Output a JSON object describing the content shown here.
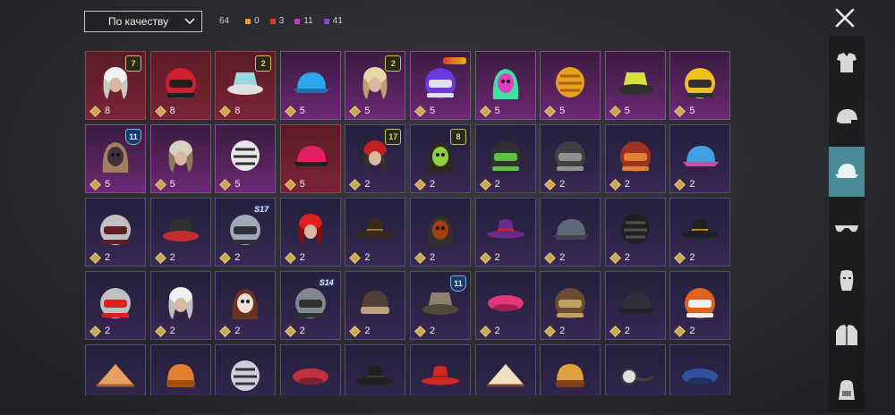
{
  "sort": {
    "label": "По качеству"
  },
  "counts": {
    "total": "64",
    "orange": {
      "value": "0",
      "color": "#e8a020"
    },
    "red": {
      "value": "3",
      "color": "#e03838"
    },
    "pink": {
      "value": "11",
      "color": "#c838c8"
    },
    "violet": {
      "value": "41",
      "color": "#8a48e0"
    }
  },
  "sidebar": [
    {
      "name": "clothing",
      "icon": "outfit-icon",
      "active": false
    },
    {
      "name": "helmet",
      "icon": "helmet-icon",
      "active": false
    },
    {
      "name": "hat",
      "icon": "cap-icon",
      "active": true
    },
    {
      "name": "glasses",
      "icon": "glasses-icon",
      "active": false
    },
    {
      "name": "mask",
      "icon": "mask-icon",
      "active": false
    },
    {
      "name": "jacket",
      "icon": "jacket-icon",
      "active": false
    },
    {
      "name": "backpack",
      "icon": "backpack-icon",
      "active": false
    }
  ],
  "items": [
    {
      "name": "white-wig",
      "rarity": "red",
      "value": "8",
      "badge": "7",
      "badge_type": "hex",
      "art": "wig",
      "c1": "#f0f0f0",
      "c2": "#c8c8c8"
    },
    {
      "name": "red-moto-helmet",
      "rarity": "red",
      "value": "8",
      "badge": "",
      "badge_type": "",
      "art": "helmet",
      "c1": "#d02030",
      "c2": "#202020"
    },
    {
      "name": "teal-bucket-hat",
      "rarity": "red",
      "value": "8",
      "badge": "2",
      "badge_type": "hex",
      "art": "bucket",
      "c1": "#9ad8e0",
      "c2": "#e0e0e0"
    },
    {
      "name": "blue-animal-cap",
      "rarity": "purple",
      "value": "5",
      "badge": "",
      "badge_type": "",
      "art": "cap",
      "c1": "#2aa8e8",
      "c2": "#1a70b0"
    },
    {
      "name": "blonde-pigtails",
      "rarity": "purple",
      "value": "5",
      "badge": "2",
      "badge_type": "hex",
      "art": "wig",
      "c1": "#e8d8a8",
      "c2": "#c0a070"
    },
    {
      "name": "purple-robot-helmet",
      "rarity": "purple",
      "value": "5",
      "badge": "",
      "badge_type": "logo",
      "art": "helmet",
      "c1": "#6a3ae0",
      "c2": "#e0e0f0"
    },
    {
      "name": "neon-mask-hood",
      "rarity": "purple",
      "value": "5",
      "badge": "",
      "badge_type": "",
      "art": "hood",
      "c1": "#e040c0",
      "c2": "#40e0a0"
    },
    {
      "name": "orange-creature-head",
      "rarity": "purple",
      "value": "5",
      "badge": "",
      "badge_type": "",
      "art": "ball",
      "c1": "#e8a020",
      "c2": "#a86010"
    },
    {
      "name": "yellow-bucket-hat",
      "rarity": "purple",
      "value": "5",
      "badge": "",
      "badge_type": "",
      "art": "bucket",
      "c1": "#d8e040",
      "c2": "#303030"
    },
    {
      "name": "yellow-helmet",
      "rarity": "purple",
      "value": "5",
      "badge": "",
      "badge_type": "",
      "art": "helmet",
      "c1": "#f0c020",
      "c2": "#303030"
    },
    {
      "name": "dark-animal-mask",
      "rarity": "purple",
      "value": "5",
      "badge": "11",
      "badge_type": "shield",
      "art": "hood",
      "c1": "#403040",
      "c2": "#a08060"
    },
    {
      "name": "dreadlock-lion",
      "rarity": "purple",
      "value": "5",
      "badge": "",
      "badge_type": "",
      "art": "wig",
      "c1": "#d8d0c0",
      "c2": "#8a7a60"
    },
    {
      "name": "zebra-mask",
      "rarity": "purple",
      "value": "5",
      "badge": "",
      "badge_type": "",
      "art": "ball",
      "c1": "#e8e8e8",
      "c2": "#303030"
    },
    {
      "name": "pink-bandana-cap",
      "rarity": "red",
      "value": "5",
      "badge": "",
      "badge_type": "",
      "art": "cap",
      "c1": "#e02060",
      "c2": "#202020"
    },
    {
      "name": "red-hair-hat",
      "rarity": "blue",
      "value": "2",
      "badge": "17",
      "badge_type": "hex",
      "art": "wig",
      "c1": "#c02020",
      "c2": "#303030"
    },
    {
      "name": "green-skull-hood",
      "rarity": "blue",
      "value": "2",
      "badge": "8",
      "badge_type": "hex",
      "art": "hood",
      "c1": "#90d040",
      "c2": "#302820"
    },
    {
      "name": "gas-mask-helmet",
      "rarity": "blue",
      "value": "2",
      "badge": "",
      "badge_type": "",
      "art": "helmet",
      "c1": "#303030",
      "c2": "#60c040"
    },
    {
      "name": "black-ops-helmet",
      "rarity": "blue",
      "value": "2",
      "badge": "",
      "badge_type": "",
      "art": "helmet",
      "c1": "#404040",
      "c2": "#909090"
    },
    {
      "name": "aviator-goggles-cap",
      "rarity": "blue",
      "value": "2",
      "badge": "",
      "badge_type": "",
      "art": "helmet",
      "c1": "#a03020",
      "c2": "#e08030"
    },
    {
      "name": "colorful-cap",
      "rarity": "blue",
      "value": "2",
      "badge": "",
      "badge_type": "",
      "art": "cap",
      "c1": "#40a0e0",
      "c2": "#e040a0"
    },
    {
      "name": "horned-helmet",
      "rarity": "blue",
      "value": "2",
      "badge": "",
      "badge_type": "",
      "art": "helmet",
      "c1": "#c0c0c8",
      "c2": "#602020"
    },
    {
      "name": "hooded-bucket",
      "rarity": "blue",
      "value": "2",
      "badge": "",
      "badge_type": "",
      "art": "bucket",
      "c1": "#303030",
      "c2": "#c03030"
    },
    {
      "name": "knight-helmet",
      "rarity": "blue",
      "value": "2",
      "badge": "S17",
      "badge_type": "season",
      "art": "helmet",
      "c1": "#a0a8b8",
      "c2": "#303038"
    },
    {
      "name": "red-mohawk",
      "rarity": "blue",
      "value": "2",
      "badge": "",
      "badge_type": "",
      "art": "wig",
      "c1": "#e02020",
      "c2": "#801010"
    },
    {
      "name": "steampunk-hat",
      "rarity": "blue",
      "value": "2",
      "badge": "",
      "badge_type": "",
      "art": "fedora",
      "c1": "#3a2a1a",
      "c2": "#a08040"
    },
    {
      "name": "cyber-mask",
      "rarity": "blue",
      "value": "2",
      "badge": "",
      "badge_type": "",
      "art": "hood",
      "c1": "#a04010",
      "c2": "#303030"
    },
    {
      "name": "purple-top-hat",
      "rarity": "blue",
      "value": "2",
      "badge": "",
      "badge_type": "",
      "art": "fedora",
      "c1": "#6a2a8a",
      "c2": "#e02020"
    },
    {
      "name": "grey-cap",
      "rarity": "blue",
      "value": "2",
      "badge": "",
      "badge_type": "",
      "art": "cap",
      "c1": "#606878",
      "c2": "#404450"
    },
    {
      "name": "black-gas-mask",
      "rarity": "blue",
      "value": "2",
      "badge": "",
      "badge_type": "",
      "art": "ball",
      "c1": "#202020",
      "c2": "#505050"
    },
    {
      "name": "black-fedora",
      "rarity": "blue",
      "value": "2",
      "badge": "",
      "badge_type": "",
      "art": "fedora",
      "c1": "#202020",
      "c2": "#c0a020"
    },
    {
      "name": "goggles-cap",
      "rarity": "blue",
      "value": "2",
      "badge": "",
      "badge_type": "",
      "art": "helmet",
      "c1": "#c0c0c0",
      "c2": "#e02020"
    },
    {
      "name": "white-turban",
      "rarity": "blue",
      "value": "2",
      "badge": "",
      "badge_type": "",
      "art": "wig",
      "c1": "#f0f0f0",
      "c2": "#c0c0c0"
    },
    {
      "name": "clown-mask",
      "rarity": "blue",
      "value": "2",
      "badge": "",
      "badge_type": "",
      "art": "hood",
      "c1": "#e8e0d8",
      "c2": "#6a3020"
    },
    {
      "name": "gladiator-helmet",
      "rarity": "blue",
      "value": "2",
      "badge": "S14",
      "badge_type": "season",
      "art": "helmet",
      "c1": "#808890",
      "c2": "#303030"
    },
    {
      "name": "brown-beanie",
      "rarity": "blue",
      "value": "2",
      "badge": "",
      "badge_type": "",
      "art": "beanie",
      "c1": "#504038",
      "c2": "#c0a080"
    },
    {
      "name": "camo-bucket",
      "rarity": "blue",
      "value": "2",
      "badge": "11",
      "badge_type": "shield",
      "art": "bucket",
      "c1": "#8a8070",
      "c2": "#504838"
    },
    {
      "name": "pink-beret",
      "rarity": "blue",
      "value": "2",
      "badge": "",
      "badge_type": "",
      "art": "beret",
      "c1": "#e03878",
      "c2": "#a02050"
    },
    {
      "name": "pilot-cap",
      "rarity": "blue",
      "value": "2",
      "badge": "",
      "badge_type": "",
      "art": "helmet",
      "c1": "#6a4a30",
      "c2": "#c0a060"
    },
    {
      "name": "black-cap",
      "rarity": "blue",
      "value": "2",
      "badge": "",
      "badge_type": "",
      "art": "cap",
      "c1": "#303038",
      "c2": "#202028"
    },
    {
      "name": "football-helmet",
      "rarity": "blue",
      "value": "2",
      "badge": "",
      "badge_type": "",
      "art": "helmet",
      "c1": "#e06020",
      "c2": "#f0f0f0"
    },
    {
      "name": "conical-hat",
      "rarity": "blue",
      "value": "",
      "badge": "",
      "badge_type": "",
      "art": "cone",
      "c1": "#e8a060",
      "c2": "#a06030"
    },
    {
      "name": "orange-beanie",
      "rarity": "blue",
      "value": "",
      "badge": "",
      "badge_type": "",
      "art": "beanie",
      "c1": "#e08030",
      "c2": "#a05010"
    },
    {
      "name": "wrestler-mask",
      "rarity": "blue",
      "value": "",
      "badge": "",
      "badge_type": "",
      "art": "ball",
      "c1": "#d0d0d8",
      "c2": "#303040"
    },
    {
      "name": "red-beret",
      "rarity": "blue",
      "value": "",
      "badge": "",
      "badge_type": "",
      "art": "beret",
      "c1": "#c03040",
      "c2": "#802030"
    },
    {
      "name": "black-top-hat",
      "rarity": "blue",
      "value": "",
      "badge": "",
      "badge_type": "",
      "art": "fedora",
      "c1": "#202020",
      "c2": "#404040"
    },
    {
      "name": "red-top-hat",
      "rarity": "blue",
      "value": "",
      "badge": "",
      "badge_type": "",
      "art": "fedora",
      "c1": "#d02828",
      "c2": "#901818"
    },
    {
      "name": "cupcake-hat",
      "rarity": "blue",
      "value": "",
      "badge": "",
      "badge_type": "",
      "art": "cone",
      "c1": "#f0e0c0",
      "c2": "#7a4020"
    },
    {
      "name": "burger-hat",
      "rarity": "blue",
      "value": "",
      "badge": "",
      "badge_type": "",
      "art": "beanie",
      "c1": "#e0a040",
      "c2": "#804020"
    },
    {
      "name": "doctor-mirror",
      "rarity": "blue",
      "value": "",
      "badge": "",
      "badge_type": "",
      "art": "ring",
      "c1": "#e0e0e0",
      "c2": "#404040"
    },
    {
      "name": "navy-garrison-cap",
      "rarity": "blue",
      "value": "",
      "badge": "",
      "badge_type": "",
      "art": "beret",
      "c1": "#3050a0",
      "c2": "#203060"
    }
  ]
}
